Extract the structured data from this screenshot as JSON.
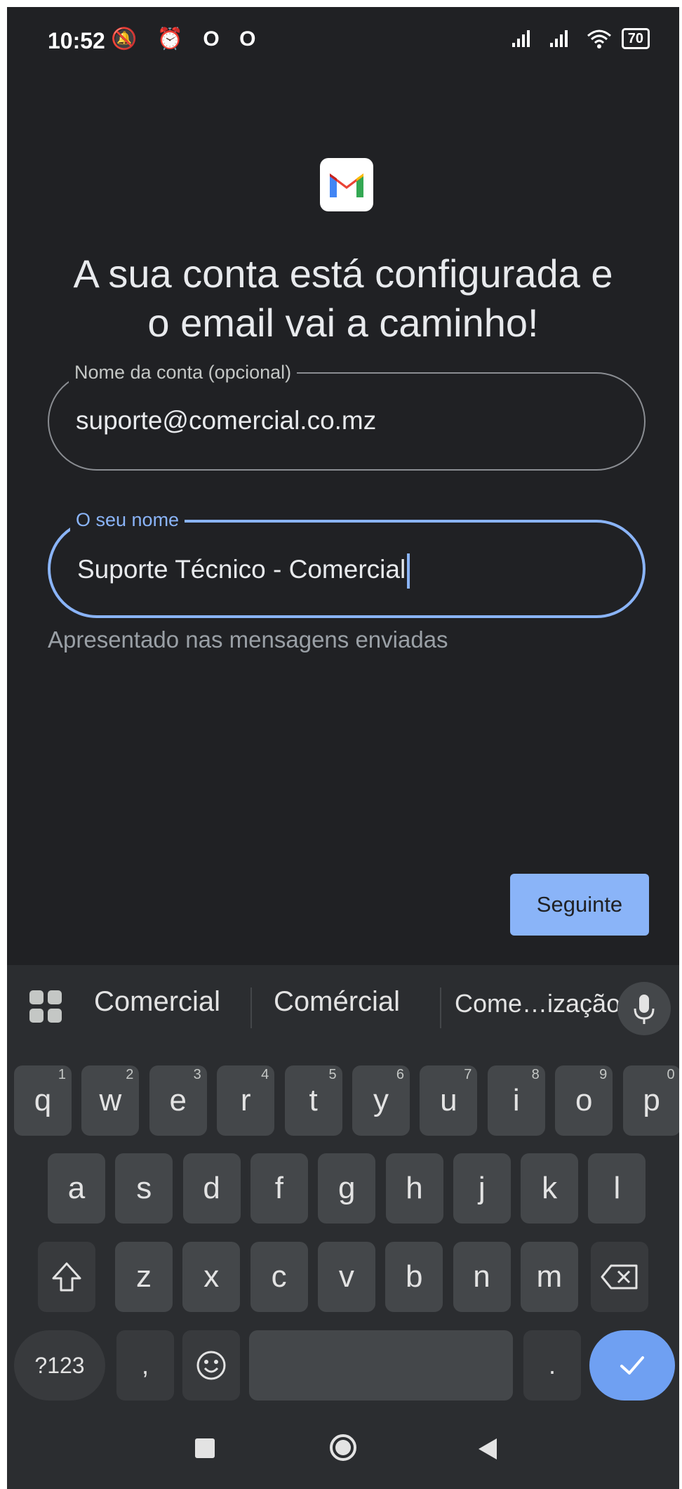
{
  "status_bar": {
    "time": "10:52",
    "battery": "70"
  },
  "title": {
    "line1": "A sua conta está configurada e",
    "line2": "o email vai a caminho!"
  },
  "account_field": {
    "label": "Nome da conta (opcional)",
    "value": "suporte@comercial.co.mz"
  },
  "name_field": {
    "label": "O seu nome",
    "value": "Suporte Técnico - Comercial"
  },
  "helper_text": "Apresentado nas mensagens enviadas",
  "next_button": "Seguinte",
  "keyboard": {
    "suggestions": [
      "Comercial",
      "Comércial",
      "Come…ização"
    ],
    "row1": [
      {
        "k": "q",
        "s": "1"
      },
      {
        "k": "w",
        "s": "2"
      },
      {
        "k": "e",
        "s": "3"
      },
      {
        "k": "r",
        "s": "4"
      },
      {
        "k": "t",
        "s": "5"
      },
      {
        "k": "y",
        "s": "6"
      },
      {
        "k": "u",
        "s": "7"
      },
      {
        "k": "i",
        "s": "8"
      },
      {
        "k": "o",
        "s": "9"
      },
      {
        "k": "p",
        "s": "0"
      }
    ],
    "row2": [
      "a",
      "s",
      "d",
      "f",
      "g",
      "h",
      "j",
      "k",
      "l"
    ],
    "row3": [
      "z",
      "x",
      "c",
      "v",
      "b",
      "n",
      "m"
    ],
    "symbols_key": "?123",
    "comma_key": ",",
    "period_key": "."
  },
  "icons": [
    "muted-bell-icon",
    "alarm-icon",
    "signal-icon",
    "wifi-icon",
    "battery-icon",
    "gmail-logo",
    "grid-icon",
    "mic-icon",
    "shift-icon",
    "backspace-icon",
    "emoji-icon",
    "check-icon",
    "recents-icon",
    "home-icon",
    "back-icon"
  ],
  "colors": {
    "background": "#202124",
    "accent": "#8ab4f8",
    "keyboard": "#2b2d30",
    "key": "#44474a"
  }
}
